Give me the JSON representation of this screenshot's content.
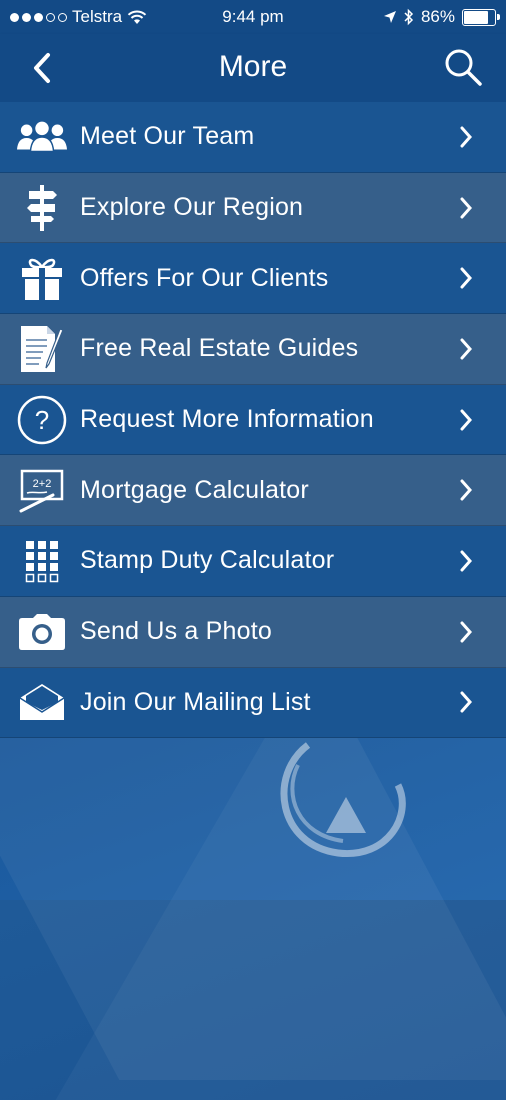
{
  "status_bar": {
    "carrier": "Telstra",
    "time": "9:44 pm",
    "battery": "86%",
    "battery_level": 0.86,
    "signal_bars_filled": 3,
    "signal_bars_total": 5
  },
  "navbar": {
    "title": "More",
    "back_icon": "chevron-left-icon",
    "search_icon": "search-icon"
  },
  "menu": {
    "items": [
      {
        "label": "Meet Our Team",
        "icon": "team-icon"
      },
      {
        "label": "Explore Our Region",
        "icon": "signpost-icon"
      },
      {
        "label": "Offers For Our Clients",
        "icon": "gift-icon"
      },
      {
        "label": "Free Real Estate Guides",
        "icon": "document-pen-icon"
      },
      {
        "label": "Request More Information",
        "icon": "question-circle-icon"
      },
      {
        "label": "Mortgage Calculator",
        "icon": "chalkboard-icon"
      },
      {
        "label": "Stamp Duty Calculator",
        "icon": "calculator-icon"
      },
      {
        "label": "Send Us a Photo",
        "icon": "camera-icon"
      },
      {
        "label": "Join Our Mailing List",
        "icon": "envelope-icon"
      }
    ]
  },
  "colors": {
    "bar": "#134a86",
    "row_dark": "#1a5592",
    "row_light": "#365f8a",
    "background": "#1e5a9a"
  }
}
